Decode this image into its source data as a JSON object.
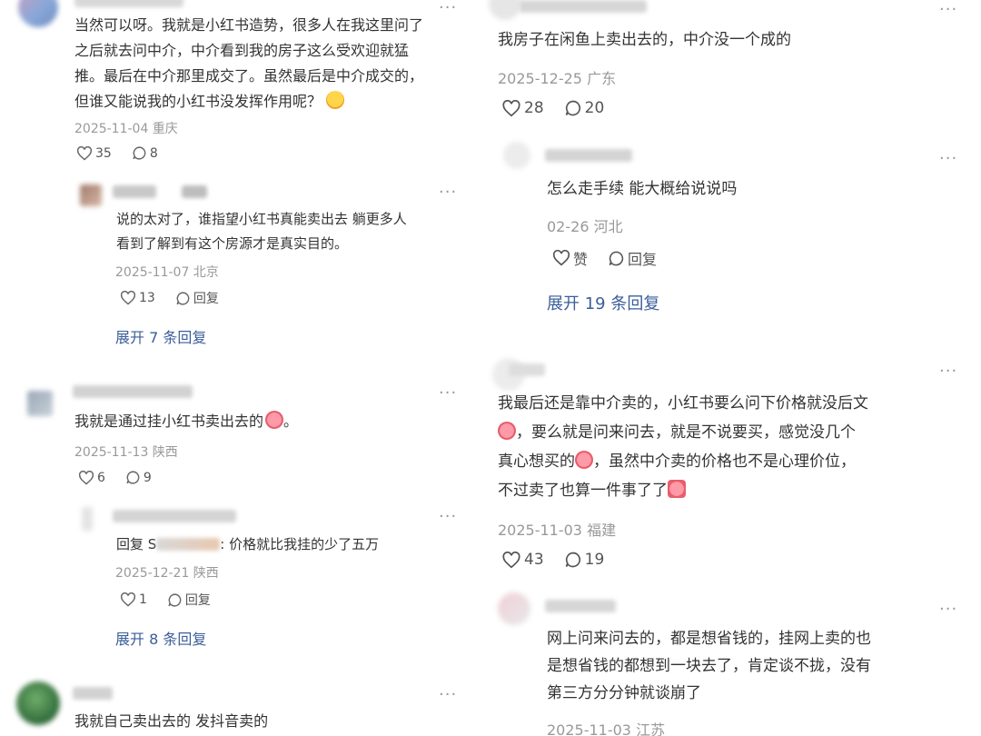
{
  "left": {
    "c1": {
      "text_l1": "当然可以呀。我就是小红书造势，很多人在我这里问了",
      "text_l2": "之后就去问中介，中介看到我的房子这么受欢迎就猛",
      "text_l3": "推。最后在中介那里成交了。虽然最后是中介成交的，",
      "text_l4": "但谁又能说我的小红书没发挥作用呢？",
      "date": "2025-11-04 重庆",
      "likes": "35",
      "replies": "8"
    },
    "c1r1": {
      "text_l1": "说的太对了，谁指望小红书真能卖出去 躺更多人",
      "text_l2": "看到了解到有这个房源才是真实目的。",
      "date": "2025-11-07 北京",
      "likes": "13",
      "reply_label": "回复"
    },
    "c1_expand": "展开 7 条回复",
    "c2": {
      "text": "我就是通过挂小红书卖出去的",
      "date": "2025-11-13 陕西",
      "likes": "6",
      "replies": "9"
    },
    "c2r1": {
      "prefix": "回复 S",
      "text": ": 价格就比我挂的少了五万",
      "date": "2025-12-21 陕西",
      "likes": "1",
      "reply_label": "回复"
    },
    "c2_expand": "展开 8 条回复",
    "c3": {
      "text": "我就自己卖出去的 发抖音卖的"
    }
  },
  "right": {
    "c1": {
      "text": "我房子在闲鱼上卖出去的，中介没一个成的",
      "date": "2025-12-25 广东",
      "likes": "28",
      "replies": "20"
    },
    "c1r1": {
      "text": "怎么走手续 能大概给说说吗",
      "date": "02-26 河北",
      "like_label": "赞",
      "reply_label": "回复"
    },
    "c1_expand": "展开 19 条回复",
    "c2": {
      "text_l1": "我最后还是靠中介卖的，小红书要么问下价格就没后文",
      "text_l2": "，要么就是问来问去，就是不说要买，感觉没几个",
      "text_l3a": "真心想买的",
      "text_l3b": "，虽然中介卖的价格也不是心理价位，",
      "text_l4": "不过卖了也算一件事了了",
      "date": "2025-11-03 福建",
      "likes": "43",
      "replies": "19"
    },
    "c2r1": {
      "text_l1": "网上问来问去的，都是想省钱的，挂网上卖的也",
      "text_l2": "是想省钱的都想到一块去了，肯定谈不拢，没有",
      "text_l3": "第三方分分钟就谈崩了",
      "date": "2025-11-03 江苏"
    }
  },
  "more_glyph": "···"
}
